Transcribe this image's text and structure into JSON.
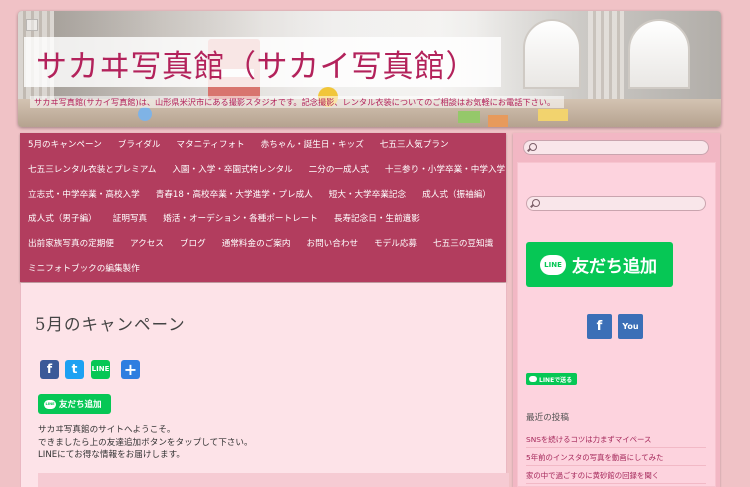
{
  "header": {
    "title": "サカヰ写真館（サカイ写真館）",
    "tagline": "サカヰ写真館(サカイ写真館)は、山形県米沢市にある撮影スタジオです。記念撮影、レンタル衣装についてのご相談はお気軽にお電話下さい。"
  },
  "nav": {
    "rows": [
      [
        "5月のキャンペーン",
        "ブライダル",
        "マタニティフォト",
        "赤ちゃん・誕生日・キッズ",
        "七五三人気プラン"
      ],
      [
        "七五三レンタル衣装とプレミアム",
        "入園・入学・卒園式袴レンタル",
        "二分の一成人式",
        "十三参り・小学卒業・中学入学"
      ],
      [
        "立志式・中学卒業・高校入学",
        "青春18・高校卒業・大学進学・プレ成人",
        "短大・大学卒業記念",
        "成人式（振袖編）"
      ],
      [
        "成人式（男子編）",
        "証明写真",
        "婚活・オーデション・各種ポートレート",
        "長寿記念日・生前遺影"
      ],
      [
        "出前家族写真の定期便",
        "アクセス",
        "ブログ",
        "通常料金のご案内",
        "お問い合わせ",
        "モデル応募",
        "七五三の豆知識"
      ],
      [
        "ミニフォトブックの編集製作"
      ]
    ]
  },
  "main": {
    "post_title": "5月のキャンペーン",
    "share_icons": [
      "facebook-icon",
      "twitter-icon",
      "line-icon",
      "share-plus-icon"
    ],
    "line_add_label": "友だち追加",
    "intro_lines": [
      "サカヰ写真館のサイトへようこそ。",
      "できましたら上の友達追加ボタンをタップして下さい。",
      "LINEにてお得な情報をお届けします。"
    ]
  },
  "sidebar": {
    "line_big_label": "友だち追加",
    "line_small_label": "LINEで送る",
    "social_icons": [
      "facebook-icon",
      "youtube-icon"
    ],
    "recent_heading": "最近の投稿",
    "recent_posts": [
      "SNSを続けるコツは力まずマイペース",
      "5年前のインスタの写真を動画にしてみた",
      "家の中で過ごすのに黄砂館の回録を聞く"
    ]
  },
  "colors": {
    "nav_bg": "#b23d5e",
    "title": "#b3225b",
    "line_green": "#06c755",
    "page_bg": "#f0c2c6"
  }
}
